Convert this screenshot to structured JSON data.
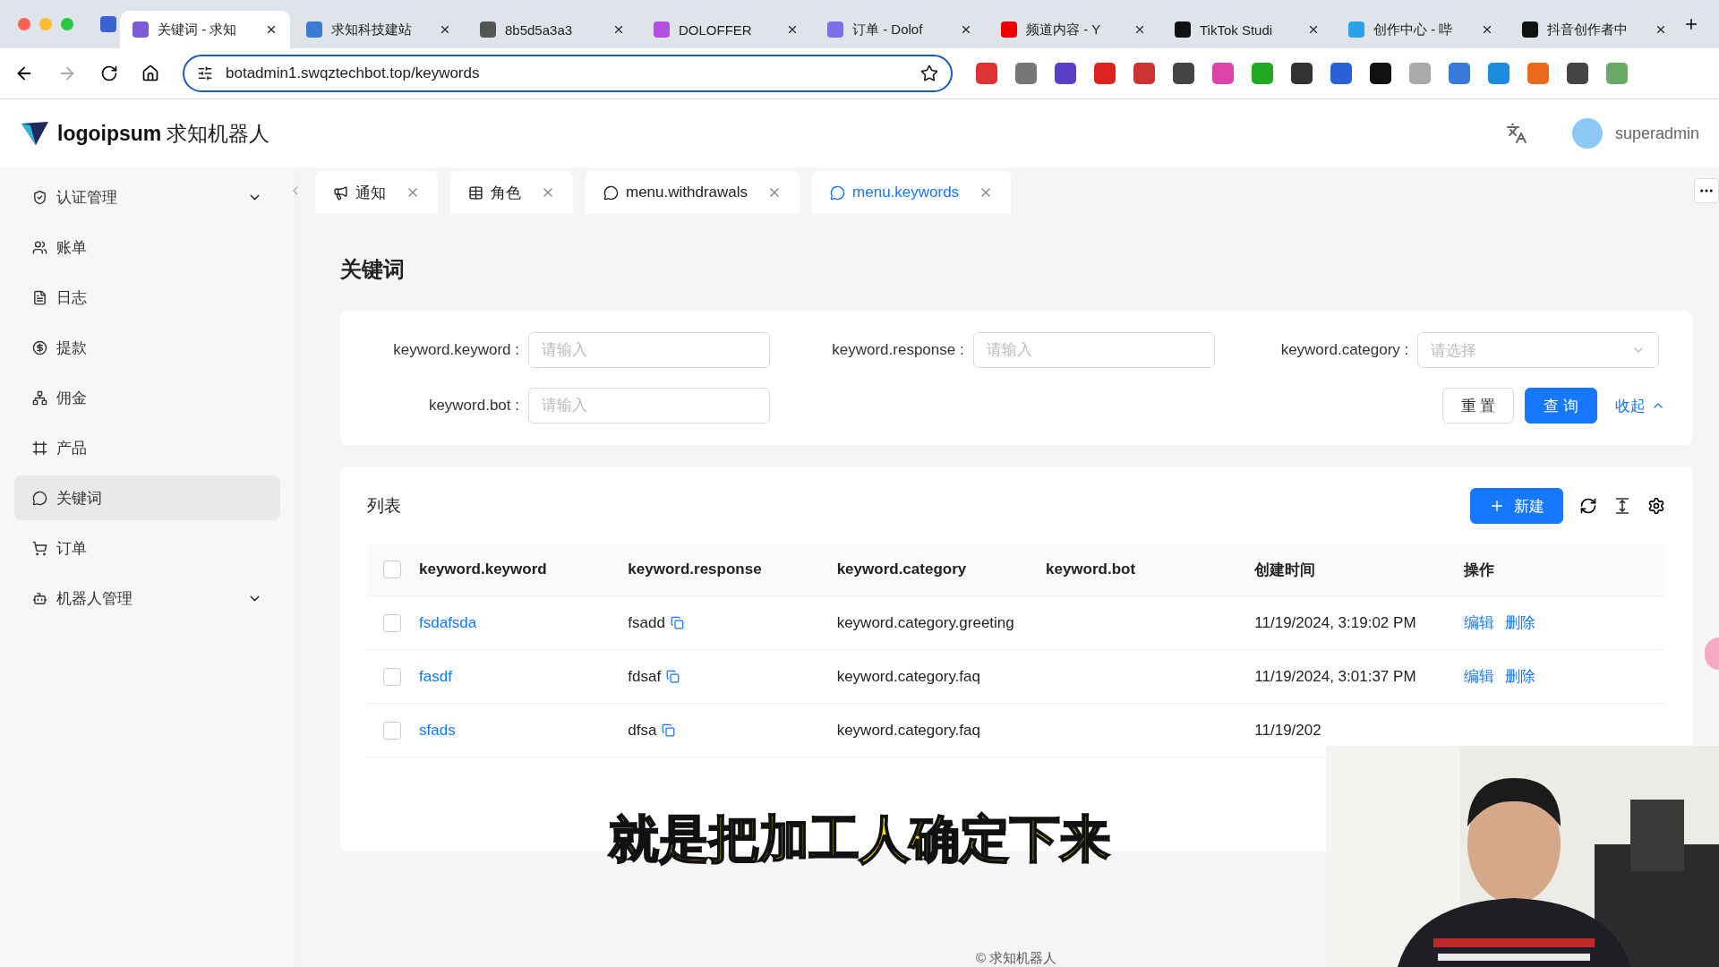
{
  "browser": {
    "tabs": [
      {
        "title": "关键词 - 求知",
        "selected": true
      },
      {
        "title": "求知科技建站",
        "selected": false
      },
      {
        "title": "8b5d5a3a3",
        "selected": false
      },
      {
        "title": "DOLOFFER",
        "selected": false
      },
      {
        "title": "订单 - Dolof",
        "selected": false
      },
      {
        "title": "频道内容 - Y",
        "selected": false
      },
      {
        "title": "TikTok Studi",
        "selected": false
      },
      {
        "title": "创作中心 - 哔",
        "selected": false
      },
      {
        "title": "抖音创作者中",
        "selected": false
      }
    ],
    "url": "botadmin1.swqztechbot.top/keywords"
  },
  "header": {
    "brand": "logoipsum",
    "app_name": "求知机器人",
    "user": "superadmin"
  },
  "sidebar": [
    {
      "label": "认证管理",
      "selected": false,
      "expandable": true
    },
    {
      "label": "账单",
      "selected": false
    },
    {
      "label": "日志",
      "selected": false
    },
    {
      "label": "提款",
      "selected": false
    },
    {
      "label": "佣金",
      "selected": false
    },
    {
      "label": "产品",
      "selected": false
    },
    {
      "label": "关键词",
      "selected": true
    },
    {
      "label": "订单",
      "selected": false
    },
    {
      "label": "机器人管理",
      "selected": false,
      "expandable": true
    }
  ],
  "page_tabs": [
    {
      "label": "通知",
      "selected": false
    },
    {
      "label": "角色",
      "selected": false
    },
    {
      "label": "menu.withdrawals",
      "selected": false
    },
    {
      "label": "menu.keywords",
      "selected": true
    }
  ],
  "page_title": "关键词",
  "filters": [
    {
      "label": "keyword.keyword :",
      "placeholder": "请输入",
      "kind": "input"
    },
    {
      "label": "keyword.response :",
      "placeholder": "请输入",
      "kind": "input"
    },
    {
      "label": "keyword.category :",
      "placeholder": "请选择",
      "kind": "select"
    },
    {
      "label": "keyword.bot :",
      "placeholder": "请输入",
      "kind": "input"
    }
  ],
  "filter_buttons": {
    "reset": "重 置",
    "search": "查 询",
    "collapse": "收起"
  },
  "table": {
    "title": "列表",
    "new_button": "新建",
    "select_all_checked": false,
    "columns": [
      "keyword.keyword",
      "keyword.response",
      "keyword.category",
      "keyword.bot",
      "创建时间",
      "操作"
    ],
    "rows": [
      {
        "checked": false,
        "keyword": "fsdafsda",
        "response": "fsadd",
        "category": "keyword.category.greeting",
        "created": "11/19/2024, 3:19:02 PM",
        "actions": [
          "编辑",
          "删除"
        ]
      },
      {
        "checked": false,
        "keyword": "fasdf",
        "response": "fdsaf",
        "category": "keyword.category.faq",
        "created": "11/19/2024, 3:01:37 PM",
        "actions": [
          "编辑",
          "删除"
        ]
      },
      {
        "checked": false,
        "keyword": "sfads",
        "response": "dfsa",
        "category": "keyword.category.faq",
        "created": "11/19/202"
      }
    ]
  },
  "subtitle": "就是把加工人确定下来",
  "footer": "© 求知机器人"
}
